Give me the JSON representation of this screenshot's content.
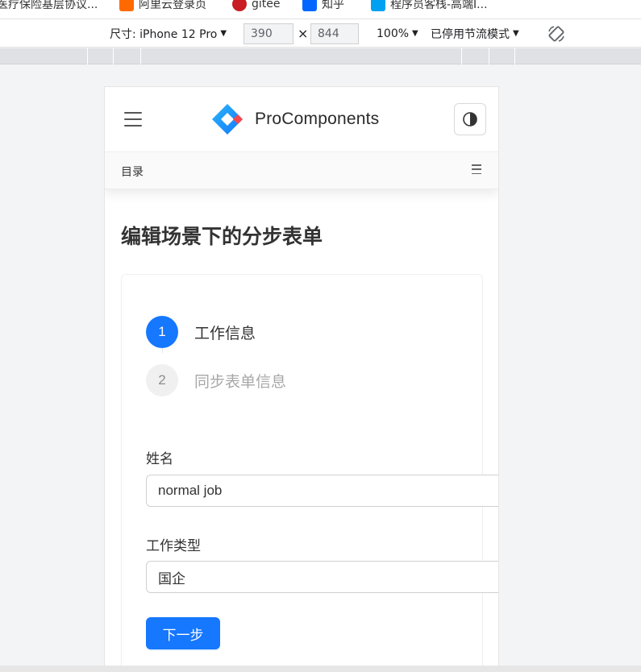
{
  "bookmarks": [
    {
      "label": "医疗保险基层协议...",
      "color": "#1a73e8"
    },
    {
      "label": "阿里云登录页",
      "color": "#ff6a00"
    },
    {
      "label": "gitee",
      "color": "#c71d23"
    },
    {
      "label": "知乎",
      "color": "#0066ff"
    },
    {
      "label": "程序员客栈-高端I...",
      "color": "#00a1f1"
    }
  ],
  "devtools": {
    "device": "尺寸: iPhone 12 Pro",
    "width": "390",
    "times": "×",
    "height": "844",
    "zoom": "100%",
    "throttle": "已停用节流模式"
  },
  "site": {
    "brand": "ProComponents",
    "toc_label": "目录"
  },
  "page": {
    "title": "编辑场景下的分步表单"
  },
  "steps": [
    {
      "number": "1",
      "title": "工作信息",
      "status": "active"
    },
    {
      "number": "2",
      "title": "同步表单信息",
      "status": "waiting"
    }
  ],
  "form": {
    "name_label": "姓名",
    "name_value": "normal job",
    "type_label": "工作类型",
    "type_value": "国企",
    "next_label": "下一步"
  },
  "colors": {
    "primary": "#1677ff",
    "step_wait_bg": "#f0f0f0"
  }
}
